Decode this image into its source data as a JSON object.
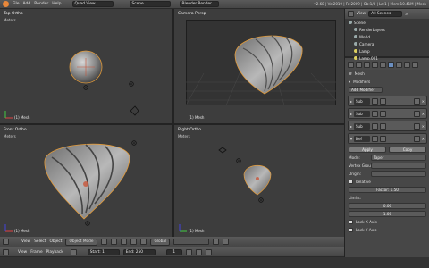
{
  "topbar": {
    "menus": [
      "File",
      "Add",
      "Render",
      "Help"
    ],
    "layout": "Quad View",
    "scene": "Scene",
    "engine": "Blender Render",
    "stats": "v2.68 | Ve:2019 | Fa:2009 | Ob:1/3 | La:1 | Mem:10.41M | Mesh"
  },
  "views": {
    "top": {
      "label": "Top Ortho",
      "sub": "Meters",
      "mesh": "(1) Mesh"
    },
    "camera": {
      "label": "Camera Persp",
      "mesh": "(1) Mesh"
    },
    "front": {
      "label": "Front Ortho",
      "sub": "Meters",
      "mesh": "(1) Mesh"
    },
    "right": {
      "label": "Right Ortho",
      "sub": "Meters",
      "mesh": "(1) Mesh"
    }
  },
  "header3d": {
    "view": "View",
    "select": "Select",
    "object": "Object",
    "mode": "Object Mode",
    "pivot": "Global"
  },
  "timeline": {
    "view": "View",
    "frame": "Frame",
    "playback": "Playback",
    "start": "Start: 1",
    "end": "End: 250",
    "current": "1"
  },
  "outliner": {
    "view": "View",
    "filter": "All Scenes",
    "rows": [
      "Scene",
      "RenderLayers",
      "World",
      "Camera",
      "Lamp",
      "Lamp.001"
    ]
  },
  "properties": {
    "object": "Mesh",
    "section": "Modifiers",
    "add": "Add Modifier",
    "modifiers": [
      "Sub",
      "Sub",
      "Sub",
      "Def"
    ],
    "apply": "Apply",
    "copy": "Copy",
    "mode_label": "Mode:",
    "mode_value": "Taper",
    "vgroup": "Vertex Grou",
    "origin": "Origin:",
    "relative": "Relative",
    "factor": "Factor: 1.50",
    "limits": "Limits:",
    "limit_min": "0.00",
    "limit_max": "1.00",
    "lock_x": "Lock X Axis",
    "lock_y": "Lock Y Axis"
  },
  "colors": {
    "accent": "#5e80a8",
    "selection_outline": "#e39b3a",
    "viewport_bg": "#3d3d3d"
  }
}
